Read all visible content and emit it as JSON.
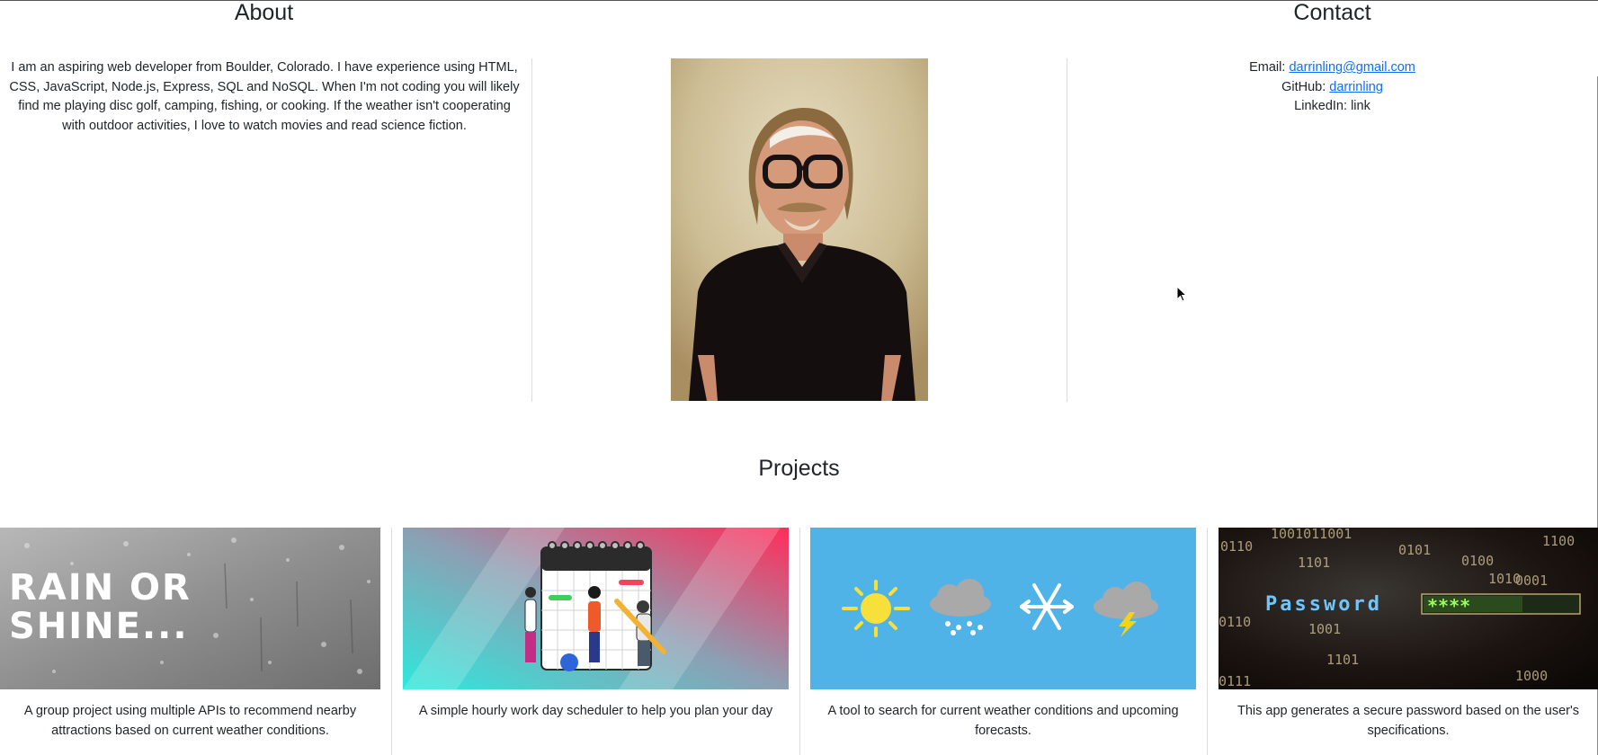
{
  "about": {
    "title": "About",
    "text": "I am an aspiring web developer from Boulder, Colorado. I have experience using HTML, CSS, JavaScript, Node.js, Express, SQL and NoSQL. When I'm not coding you will likely find me playing disc golf, camping, fishing, or cooking. If the weather isn't cooperating with outdoor activities, I love to watch movies and read science fiction."
  },
  "contact": {
    "title": "Contact",
    "email_label": "Email:",
    "email_value": "darrinling@gmail.com",
    "github_label": "GitHub:",
    "github_value": "darrinling",
    "linkedin_label": "LinkedIn:",
    "linkedin_value": "link"
  },
  "projects": {
    "title": "Projects",
    "cards": [
      {
        "image": "rain-window-image",
        "image_text_line1": "RAIN OR",
        "image_text_line2": "SHINE...",
        "description": "A group project using multiple APIs to recommend nearby attractions based on current weather conditions."
      },
      {
        "image": "scheduler-illustration",
        "description": "A simple hourly work day scheduler to help you plan your day"
      },
      {
        "image": "weather-icons-image",
        "description": "A tool to search for current weather conditions and upcoming forecasts."
      },
      {
        "image": "password-binary-image",
        "image_text": "Password",
        "image_mask": "****",
        "binary_tokens": [
          "1001011001",
          "0110",
          "0101",
          "0100",
          "1101",
          "1010",
          "0001",
          "1100",
          "0110",
          "1001",
          "1101",
          "0111",
          "1000"
        ],
        "description": "This app generates a secure password based on the user's specifications."
      }
    ]
  },
  "colors": {
    "link": "#0d6efd",
    "weather_bg": "#4fb3e8",
    "divider": "#dcdcdc"
  }
}
